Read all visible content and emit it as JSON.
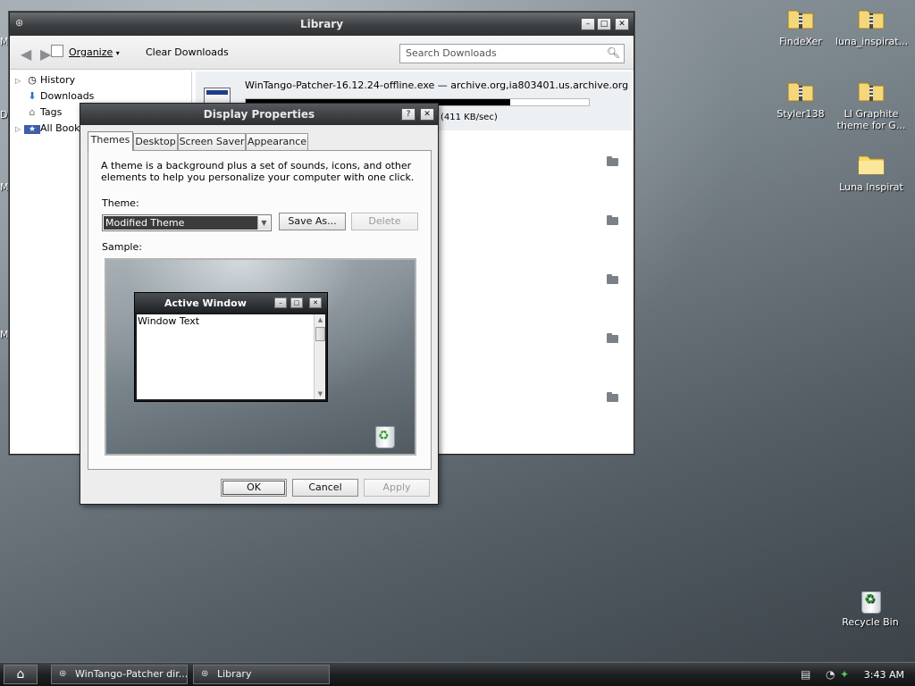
{
  "desktop": {
    "icons": [
      {
        "label": "FindeXer"
      },
      {
        "label": "luna_inspirat..."
      },
      {
        "label": "Styler138"
      },
      {
        "label": "LI Graphite theme for G..."
      },
      {
        "label": "Luna Inspirat"
      },
      {
        "label": "Recycle Bin"
      }
    ],
    "edge_letters": [
      "M",
      "D",
      "M",
      "M"
    ]
  },
  "library": {
    "title": "Library",
    "toolbar": {
      "organize": "Organize",
      "clear": "Clear Downloads",
      "search_placeholder": "Search Downloads"
    },
    "sidebar": {
      "items": [
        {
          "label": "History"
        },
        {
          "label": "Downloads"
        },
        {
          "label": "Tags"
        },
        {
          "label": "All Bookm"
        }
      ]
    },
    "download": {
      "filename": "WinTango-Patcher-16.12.24-offline.exe — archive.org,ia803401.us.archive.org",
      "speed": "(411 KB/sec)",
      "progress": 0.77
    }
  },
  "dialog": {
    "title": "Display Properties",
    "tabs": [
      {
        "label": "Themes"
      },
      {
        "label": "Desktop"
      },
      {
        "label": "Screen Saver"
      },
      {
        "label": "Appearance"
      }
    ],
    "description": "A theme is a background plus a set of sounds, icons, and other elements to help you personalize your computer with one click.",
    "theme_label": "Theme:",
    "theme_value": "Modified Theme",
    "save_as": "Save As...",
    "delete": "Delete",
    "sample_label": "Sample:",
    "sample": {
      "window_title": "Active Window",
      "window_text": "Window Text"
    },
    "buttons": {
      "ok": "OK",
      "cancel": "Cancel",
      "apply": "Apply"
    }
  },
  "taskbar": {
    "tasks": [
      {
        "label": "WinTango-Patcher dir..."
      },
      {
        "label": "Library"
      }
    ],
    "clock": "3:43 AM"
  }
}
